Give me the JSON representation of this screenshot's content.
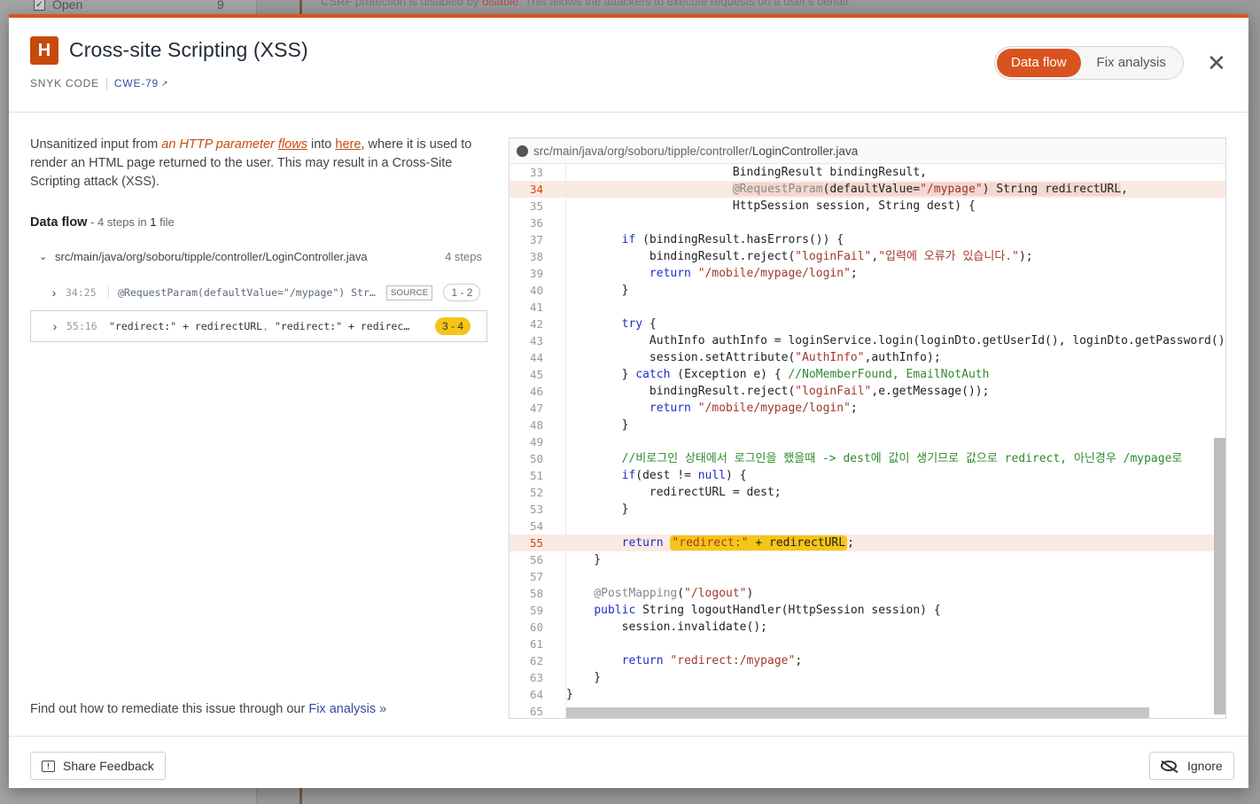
{
  "background": {
    "filter_label": "Open",
    "filter_count": "9",
    "snippet_prefix": "CSRF protection is disabled by ",
    "snippet_red": "disable",
    "snippet_suffix": ". This allows the attackers to execute requests on a user's behalf."
  },
  "header": {
    "severity": "H",
    "title": "Cross-site Scripting (XSS)",
    "source": "SNYK CODE",
    "cwe": "CWE-79",
    "tabs": [
      "Data flow",
      "Fix analysis"
    ],
    "active_tab": "Data flow",
    "close_symbol": "✕"
  },
  "description": {
    "p1": "Unsanitized input from ",
    "a1": "an HTTP parameter",
    "a2": "flows",
    "p2": " into ",
    "a3": "here",
    "p3": ", where it is used to render an HTML page returned to the user. This may result in a Cross-Site Scripting attack (XSS)."
  },
  "dataflow": {
    "title": "Data flow",
    "sep": " - ",
    "steps_count": "4",
    "steps_word": " steps in ",
    "file_count": "1",
    "file_word": " file",
    "file": "src/main/java/org/soboru/tipple/controller/LoginController.java",
    "file_steps": "4 steps",
    "items": [
      {
        "pos": "34:25",
        "code": "@RequestParam(defaultValue=\"/mypage\") Str…",
        "tag": "SOURCE",
        "range": "1 - 2"
      },
      {
        "pos": "55:16",
        "code": "\"redirect:\" + redirectURL",
        "code2": "\"redirect:\" + redirec…",
        "range": "3 - 4"
      }
    ]
  },
  "remediate": {
    "text": "Find out how to remediate this issue through our ",
    "link": "Fix analysis »"
  },
  "code": {
    "path_prefix": "src/main/java/org/soboru/tipple/controller/",
    "path_file": "LoginController.java"
  },
  "footer": {
    "feedback": "Share Feedback",
    "ignore": "Ignore"
  },
  "colors": {
    "accent": "#d9531e",
    "severity_high": "#c74a0c",
    "sink_highlight": "#f5c518",
    "link": "#3a4a9e"
  }
}
